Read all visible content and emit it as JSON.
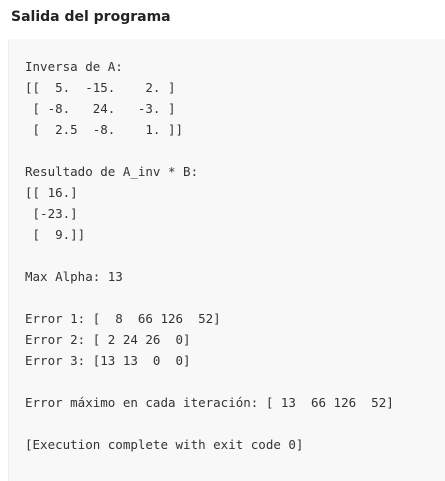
{
  "panel": {
    "title": "Salida del programa"
  },
  "output": {
    "inverse_header": "Inversa de A:",
    "inverse_rows": [
      "[[  5.  -15.    2. ]",
      " [ -8.   24.   -3. ]",
      " [  2.5  -8.    1. ]]"
    ],
    "result_header": "Resultado de A_inv * B:",
    "result_rows": [
      "[[ 16.]",
      " [-23.]",
      " [  9.]]"
    ],
    "max_alpha": "Max Alpha: 13",
    "errors": [
      "Error 1: [  8  66 126  52]",
      "Error 2: [ 2 24 26  0]",
      "Error 3: [13 13  0  0]"
    ],
    "max_error_per_iteration": "Error máximo en cada iteración: [ 13  66 126  52]",
    "exit_message": "[Execution complete with exit code 0]"
  }
}
